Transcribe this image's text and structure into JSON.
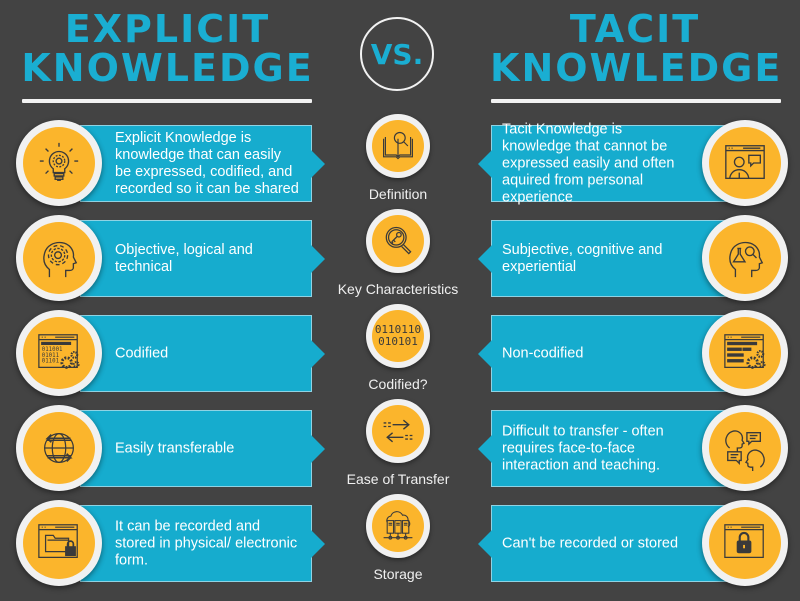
{
  "header": {
    "left_title_line1": "EXPLICIT",
    "left_title_line2": "KNOWLEDGE",
    "vs_label": "VS.",
    "right_title_line1": "TACIT",
    "right_title_line2": "KNOWLEDGE"
  },
  "colors": {
    "background": "#434343",
    "accent_teal": "#16acce",
    "icon_orange": "#fbb52c",
    "title_blue": "#1aaed2"
  },
  "rows": [
    {
      "category": "Definition",
      "center_icon": "book-magnifier-icon",
      "explicit": {
        "text": "Explicit Knowledge is knowledge that can easily be expressed, codified, and recorded so it can be shared",
        "icon": "lightbulb-gear-icon"
      },
      "tacit": {
        "text": "Tacit Knowledge is knowledge that cannot be expressed easily and often aquired from personal experience",
        "icon": "person-screen-chat-icon"
      }
    },
    {
      "category": "Key Characteristics",
      "center_icon": "key-magnifier-icon",
      "explicit": {
        "text": "Objective, logical and technical",
        "icon": "head-gear-icon"
      },
      "tacit": {
        "text": "Subjective, cognitive and experiential",
        "icon": "head-flask-icon"
      }
    },
    {
      "category": "Codified?",
      "center_icon": "binary-code-icon",
      "center_bits_line1": "0110110",
      "center_bits_line2": "010101",
      "explicit": {
        "text": "Codified",
        "icon": "code-window-gears-icon",
        "bits": [
          "011001",
          "01011",
          "01101"
        ]
      },
      "tacit": {
        "text": "Non-codified",
        "icon": "text-window-gears-icon"
      }
    },
    {
      "category": "Ease of Transfer",
      "center_icon": "transfer-arrows-icon",
      "explicit": {
        "text": "Easily transferable",
        "icon": "globe-arrows-icon"
      },
      "tacit": {
        "text": "Difficult to transfer - often requires face-to-face interaction and teaching.",
        "icon": "heads-conversation-icon"
      }
    },
    {
      "category": "Storage",
      "center_icon": "cloud-servers-icon",
      "explicit": {
        "text": "It can be recorded and stored in physical/ electronic form.",
        "icon": "folder-lock-window-icon"
      },
      "tacit": {
        "text": "Can't be recorded or stored",
        "icon": "window-lock-icon"
      }
    }
  ]
}
